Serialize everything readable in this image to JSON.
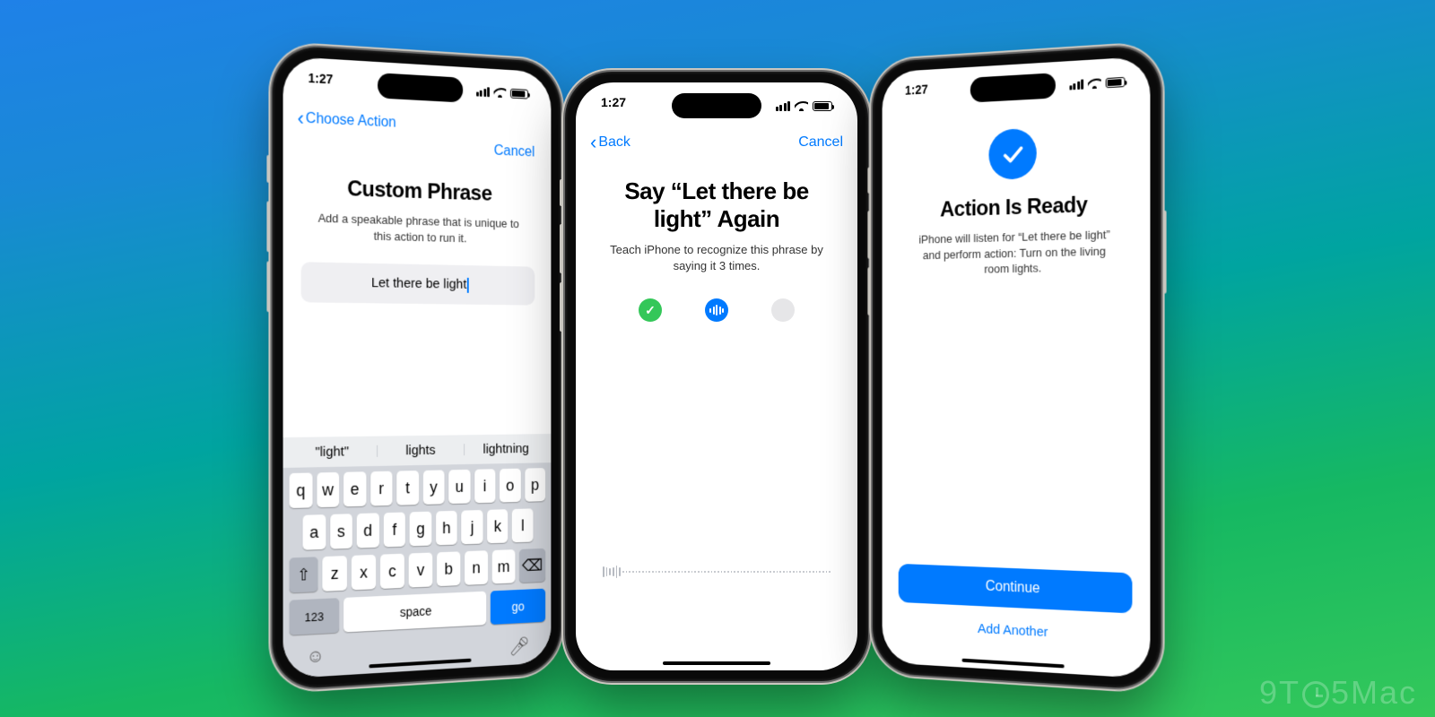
{
  "watermark": "9TO5Mac",
  "status_time": "1:27",
  "left": {
    "back_label": "Choose Action",
    "cancel": "Cancel",
    "title": "Custom Phrase",
    "subtitle": "Add a speakable phrase that is unique to this action to run it.",
    "input_value": "Let there be light",
    "suggestions": [
      "\"light\"",
      "lights",
      "lightning"
    ],
    "kbd_rows": [
      [
        "q",
        "w",
        "e",
        "r",
        "t",
        "y",
        "u",
        "i",
        "o",
        "p"
      ],
      [
        "a",
        "s",
        "d",
        "f",
        "g",
        "h",
        "j",
        "k",
        "l"
      ],
      [
        "z",
        "x",
        "c",
        "v",
        "b",
        "n",
        "m"
      ]
    ],
    "key_123": "123",
    "key_space": "space",
    "key_go": "go"
  },
  "center": {
    "back_label": "Back",
    "cancel": "Cancel",
    "title": "Say “Let there be light” Again",
    "subtitle": "Teach iPhone to recognize this phrase by saying it 3 times."
  },
  "right": {
    "title": "Action Is Ready",
    "subtitle": "iPhone will listen for “Let there be light” and perform action: Turn on the living room lights.",
    "continue": "Continue",
    "add_another": "Add Another"
  }
}
